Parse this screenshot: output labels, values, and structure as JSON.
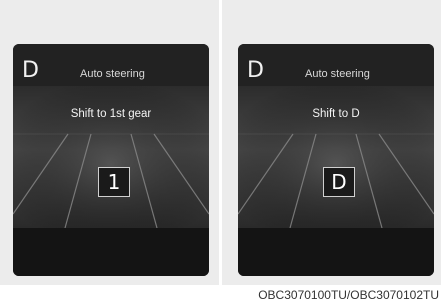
{
  "panels": [
    {
      "gear_indicator": "D",
      "mode_label": "Auto steering",
      "message": "Shift to 1st gear",
      "gear_box": "1"
    },
    {
      "gear_indicator": "D",
      "mode_label": "Auto steering",
      "message": "Shift to D",
      "gear_box": "D"
    }
  ],
  "caption": "OBC3070100TU/OBC3070102TU"
}
